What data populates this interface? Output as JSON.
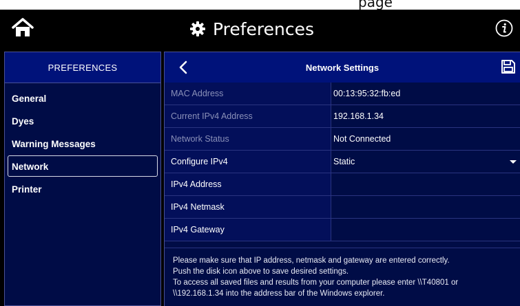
{
  "header": {
    "title": "Preferences",
    "overflow_text": "page"
  },
  "sidebar": {
    "heading": "PREFERENCES",
    "items": [
      {
        "label": "General"
      },
      {
        "label": "Dyes"
      },
      {
        "label": "Warning Messages"
      },
      {
        "label": "Network",
        "active": true
      },
      {
        "label": "Printer"
      }
    ]
  },
  "panel": {
    "title": "Network Settings",
    "rows": [
      {
        "label": "MAC Address",
        "value": "00:13:95:32:fb:ed"
      },
      {
        "label": "Current IPv4 Address",
        "value": "192.168.1.34"
      },
      {
        "label": "Network Status",
        "value": "Not Connected"
      },
      {
        "label": "Configure IPv4",
        "value": "Static"
      },
      {
        "label": "IPv4 Address",
        "value": ""
      },
      {
        "label": "IPv4 Netmask",
        "value": ""
      },
      {
        "label": "IPv4 Gateway",
        "value": ""
      }
    ],
    "note_lines": [
      "Please make sure that IP address, netmask and gateway are entered correctly.",
      "Push the disk icon above to save desired settings.",
      "To access all saved files and results from your computer please enter \\\\T40801 or",
      "\\\\192.168.1.34 into the address bar of the Windows explorer."
    ]
  },
  "colors": {
    "background": "#000000",
    "panel_bg": "#000c46",
    "header_bg": "#00127a",
    "row_label_bg": "#030f5a",
    "border": "#4a5296"
  },
  "icons": {
    "home": "home-icon",
    "settings": "gear-icon",
    "info": "info-icon",
    "back": "chevron-left-icon",
    "save": "floppy-disk-icon",
    "dropdown": "caret-down-icon"
  }
}
